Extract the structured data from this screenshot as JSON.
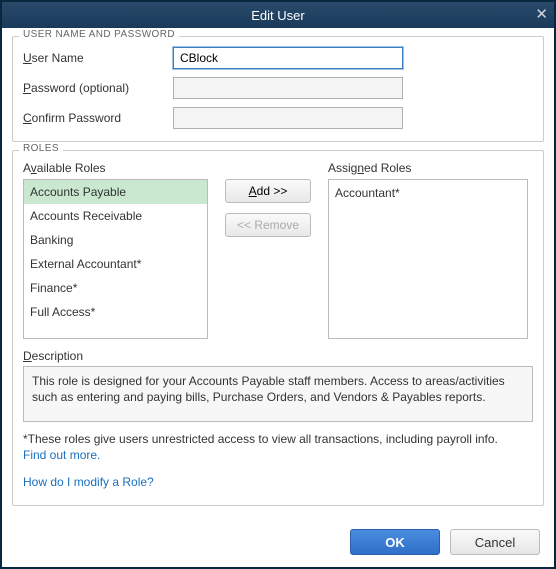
{
  "window": {
    "title": "Edit User"
  },
  "section_user": {
    "legend": "USER NAME AND PASSWORD",
    "username_label_pre": "U",
    "username_label_post": "ser Name",
    "username_value": "CBlock",
    "password_label_pre": "P",
    "password_label_post": "assword (optional)",
    "password_value": "",
    "confirm_label_pre": "C",
    "confirm_label_post": "onfirm Password",
    "confirm_value": ""
  },
  "section_roles": {
    "legend": "ROLES",
    "available_label_pre": "A",
    "available_label_mid": "v",
    "available_label_post": "ailable Roles",
    "assigned_label_pre": "Assig",
    "assigned_label_mid": "n",
    "assigned_label_post": "ed Roles",
    "available_items": [
      "Accounts Payable",
      "Accounts Receivable",
      "Banking",
      "External Accountant*",
      "Finance*",
      "Full Access*"
    ],
    "assigned_items": [
      "Accountant*"
    ],
    "add_btn_pre": "A",
    "add_btn_post": "dd >>",
    "remove_btn": "<< Remove",
    "description_label_pre": "D",
    "description_label_post": "escription",
    "description_text": "This role is designed for your Accounts Payable staff members. Access to areas/activities such as entering and paying bills, Purchase Orders, and Vendors & Payables reports.",
    "note_text": "*These roles give users unrestricted access to view all transactions, including payroll info.",
    "find_out_more": "Find out more.",
    "modify_link": "How do I modify a Role?"
  },
  "footer": {
    "ok": "OK",
    "cancel": "Cancel"
  }
}
